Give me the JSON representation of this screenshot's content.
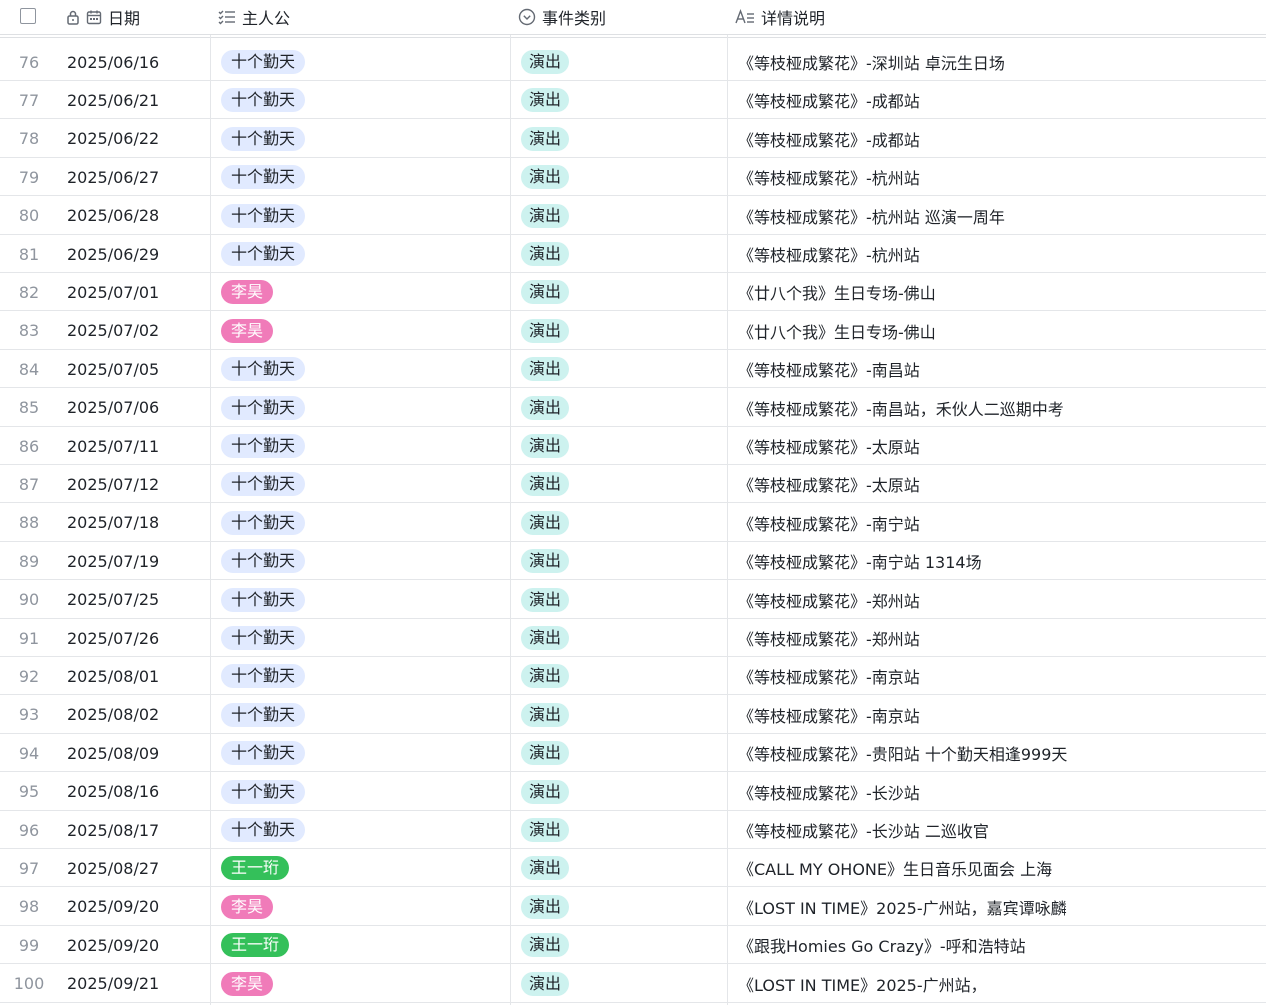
{
  "header": {
    "date": "日期",
    "host": "主人公",
    "type": "事件类别",
    "desc": "详情说明"
  },
  "tag_colors": {
    "十个勤天": {
      "bg": "#e1eaff",
      "fg": "#1f2329"
    },
    "李昊": {
      "bg": "#f07bb9",
      "fg": "#ffffff"
    },
    "王一珩": {
      "bg": "#34c05a",
      "fg": "#ffffff"
    },
    "演出": {
      "bg": "#cdf2ef",
      "fg": "#1f2329"
    }
  },
  "rows": [
    {
      "num": "76",
      "date": "2025/06/16",
      "host": "十个勤天",
      "type": "演出",
      "desc": "《等枝桠成繁花》-深圳站 卓沅生日场"
    },
    {
      "num": "77",
      "date": "2025/06/21",
      "host": "十个勤天",
      "type": "演出",
      "desc": "《等枝桠成繁花》-成都站"
    },
    {
      "num": "78",
      "date": "2025/06/22",
      "host": "十个勤天",
      "type": "演出",
      "desc": "《等枝桠成繁花》-成都站"
    },
    {
      "num": "79",
      "date": "2025/06/27",
      "host": "十个勤天",
      "type": "演出",
      "desc": "《等枝桠成繁花》-杭州站"
    },
    {
      "num": "80",
      "date": "2025/06/28",
      "host": "十个勤天",
      "type": "演出",
      "desc": "《等枝桠成繁花》-杭州站 巡演一周年"
    },
    {
      "num": "81",
      "date": "2025/06/29",
      "host": "十个勤天",
      "type": "演出",
      "desc": "《等枝桠成繁花》-杭州站"
    },
    {
      "num": "82",
      "date": "2025/07/01",
      "host": "李昊",
      "type": "演出",
      "desc": "《廿八个我》生日专场-佛山"
    },
    {
      "num": "83",
      "date": "2025/07/02",
      "host": "李昊",
      "type": "演出",
      "desc": "《廿八个我》生日专场-佛山"
    },
    {
      "num": "84",
      "date": "2025/07/05",
      "host": "十个勤天",
      "type": "演出",
      "desc": "《等枝桠成繁花》-南昌站"
    },
    {
      "num": "85",
      "date": "2025/07/06",
      "host": "十个勤天",
      "type": "演出",
      "desc": "《等枝桠成繁花》-南昌站，禾伙人二巡期中考"
    },
    {
      "num": "86",
      "date": "2025/07/11",
      "host": "十个勤天",
      "type": "演出",
      "desc": "《等枝桠成繁花》-太原站"
    },
    {
      "num": "87",
      "date": "2025/07/12",
      "host": "十个勤天",
      "type": "演出",
      "desc": "《等枝桠成繁花》-太原站"
    },
    {
      "num": "88",
      "date": "2025/07/18",
      "host": "十个勤天",
      "type": "演出",
      "desc": "《等枝桠成繁花》-南宁站"
    },
    {
      "num": "89",
      "date": "2025/07/19",
      "host": "十个勤天",
      "type": "演出",
      "desc": "《等枝桠成繁花》-南宁站 1314场"
    },
    {
      "num": "90",
      "date": "2025/07/25",
      "host": "十个勤天",
      "type": "演出",
      "desc": "《等枝桠成繁花》-郑州站"
    },
    {
      "num": "91",
      "date": "2025/07/26",
      "host": "十个勤天",
      "type": "演出",
      "desc": "《等枝桠成繁花》-郑州站"
    },
    {
      "num": "92",
      "date": "2025/08/01",
      "host": "十个勤天",
      "type": "演出",
      "desc": "《等枝桠成繁花》-南京站"
    },
    {
      "num": "93",
      "date": "2025/08/02",
      "host": "十个勤天",
      "type": "演出",
      "desc": "《等枝桠成繁花》-南京站"
    },
    {
      "num": "94",
      "date": "2025/08/09",
      "host": "十个勤天",
      "type": "演出",
      "desc": "《等枝桠成繁花》-贵阳站 十个勤天相逢999天"
    },
    {
      "num": "95",
      "date": "2025/08/16",
      "host": "十个勤天",
      "type": "演出",
      "desc": "《等枝桠成繁花》-长沙站"
    },
    {
      "num": "96",
      "date": "2025/08/17",
      "host": "十个勤天",
      "type": "演出",
      "desc": "《等枝桠成繁花》-长沙站 二巡收官"
    },
    {
      "num": "97",
      "date": "2025/08/27",
      "host": "王一珩",
      "type": "演出",
      "desc": "《CALL MY OHONE》生日音乐见面会 上海"
    },
    {
      "num": "98",
      "date": "2025/09/20",
      "host": "李昊",
      "type": "演出",
      "desc": "《LOST IN TIME》2025-广州站，嘉宾谭咏麟"
    },
    {
      "num": "99",
      "date": "2025/09/20",
      "host": "王一珩",
      "type": "演出",
      "desc": "《跟我Homies Go Crazy》-呼和浩特站"
    },
    {
      "num": "100",
      "date": "2025/09/21",
      "host": "李昊",
      "type": "演出",
      "desc": "《LOST IN TIME》2025-广州站，"
    }
  ]
}
